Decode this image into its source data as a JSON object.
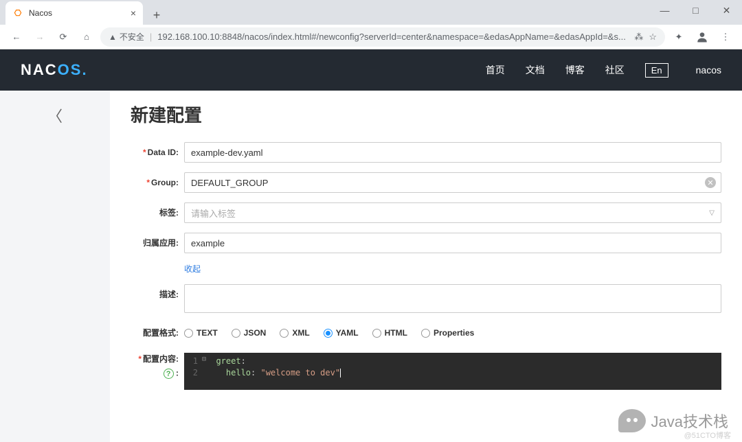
{
  "browser": {
    "tab_title": "Nacos",
    "insecure_label": "不安全",
    "url": "192.168.100.10:8848/nacos/index.html#/newconfig?serverId=center&namespace=&edasAppName=&edasAppId=&s..."
  },
  "header": {
    "logo_p1": "NAC",
    "logo_p2": "OS",
    "nav": {
      "home": "首页",
      "docs": "文档",
      "blog": "博客",
      "community": "社区",
      "lang": "En",
      "user": "nacos"
    }
  },
  "page": {
    "title": "新建配置",
    "labels": {
      "data_id": "Data ID:",
      "group": "Group:",
      "tags": "标签:",
      "app": "归属应用:",
      "collapse": "收起",
      "desc": "描述:",
      "format": "配置格式:",
      "content": "配置内容:"
    },
    "values": {
      "data_id": "example-dev.yaml",
      "group": "DEFAULT_GROUP",
      "tags_placeholder": "请输入标签",
      "app": "example"
    },
    "formats": {
      "text": "TEXT",
      "json": "JSON",
      "xml": "XML",
      "yaml": "YAML",
      "html": "HTML",
      "properties": "Properties",
      "selected": "YAML"
    },
    "editor": {
      "line1_num": "1",
      "line2_num": "2",
      "l1_key": "greet",
      "l1_colon": ":",
      "l2_key": "hello",
      "l2_colon": ": ",
      "l2_val": "\"welcome to dev\""
    }
  },
  "watermark": {
    "text": "Java技术栈",
    "cto": "@51CTO博客"
  }
}
